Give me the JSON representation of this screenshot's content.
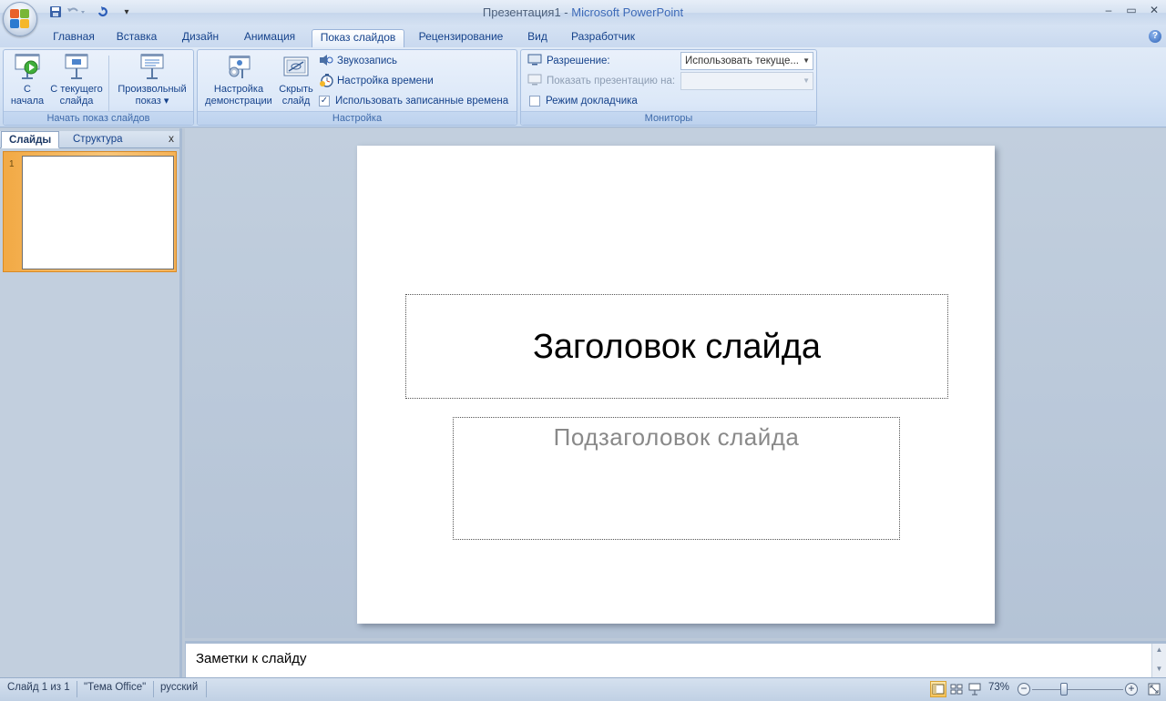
{
  "window": {
    "doc_title": "Презентация1",
    "separator": " - ",
    "app_name": "Microsoft PowerPoint",
    "minimize": "–",
    "restore": "▭",
    "close": "✕"
  },
  "qat": {
    "save_icon": "save-icon",
    "undo_icon": "undo-icon",
    "redo_icon": "redo-icon",
    "customize": "▾"
  },
  "tabs": [
    {
      "label": "Главная"
    },
    {
      "label": "Вставка"
    },
    {
      "label": "Дизайн"
    },
    {
      "label": "Анимация"
    },
    {
      "label": "Показ слайдов",
      "active": true
    },
    {
      "label": "Рецензирование"
    },
    {
      "label": "Вид"
    },
    {
      "label": "Разработчик"
    }
  ],
  "help": "?",
  "ribbon": {
    "start": {
      "label": "Начать показ слайдов",
      "from_beginning_l1": "С",
      "from_beginning_l2": "начала",
      "from_current_l1": "С текущего",
      "from_current_l2": "слайда",
      "custom_l1": "Произвольный",
      "custom_l2": "показ ▾"
    },
    "setup": {
      "label": "Настройка",
      "setup_show_l1": "Настройка",
      "setup_show_l2": "демонстрации",
      "hide_slide_l1": "Скрыть",
      "hide_slide_l2": "слайд",
      "record_narration": "Звукозапись",
      "rehearse_timings": "Настройка времени",
      "use_timings": "Использовать записанные времена",
      "use_timings_checked": "✓"
    },
    "monitors": {
      "label": "Мониторы",
      "resolution_label": "Разрешение:",
      "resolution_value": "Использовать текуще...",
      "show_on_label": "Показать презентацию на:",
      "show_on_value": "",
      "presenter_view": "Режим докладчика"
    }
  },
  "left_pane": {
    "tab_slides": "Слайды",
    "tab_outline": "Структура",
    "close": "x",
    "slide_number": "1"
  },
  "slide": {
    "title": "Заголовок слайда",
    "subtitle": "Подзаголовок слайда"
  },
  "notes": {
    "placeholder": "Заметки к слайду"
  },
  "status": {
    "slide_info": "Слайд 1 из 1",
    "theme": "\"Тема Office\"",
    "language": "русский",
    "zoom": "73%",
    "zoom_minus": "−",
    "zoom_plus": "+"
  }
}
